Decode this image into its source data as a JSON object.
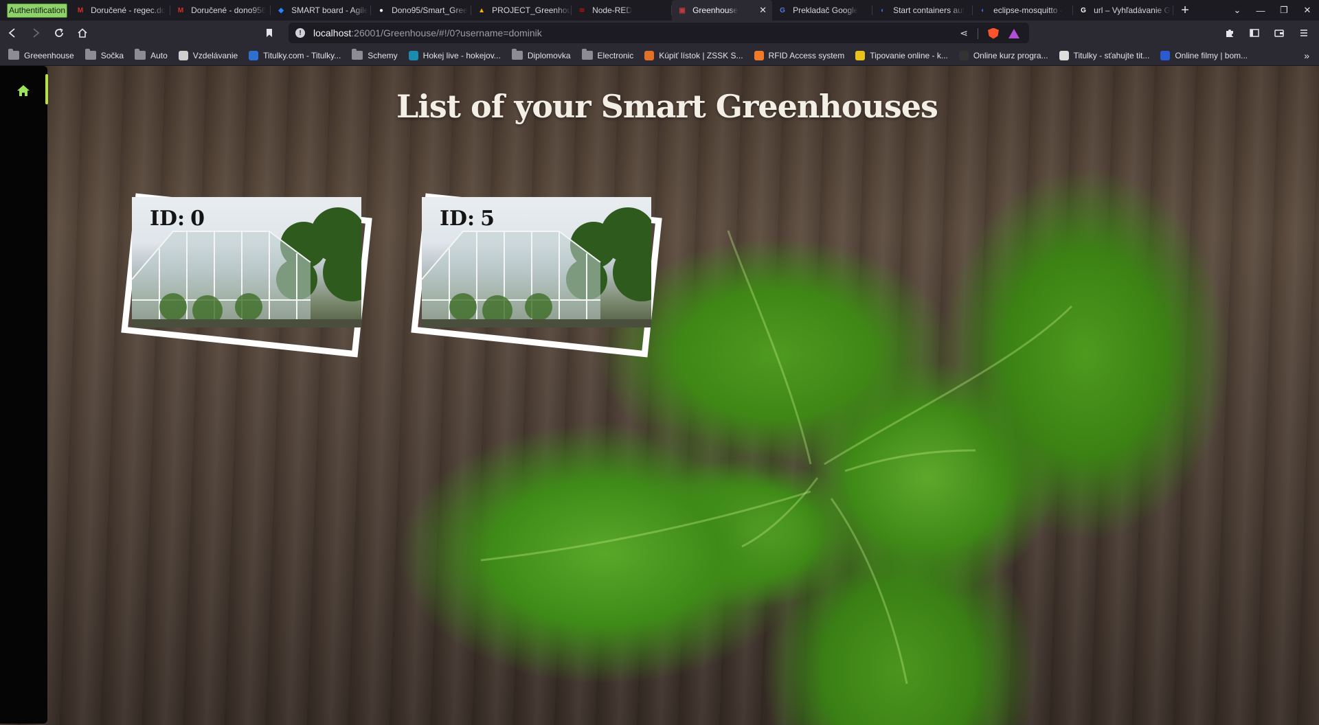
{
  "browser": {
    "auth_pill": "Authentification",
    "tabs": [
      {
        "label": "Doručené - regec.do",
        "icon": "gmail-icon",
        "color": "#d93025",
        "glyph": "M"
      },
      {
        "label": "Doručené - dono956",
        "icon": "gmail-icon",
        "color": "#d93025",
        "glyph": "M"
      },
      {
        "label": "SMART board - Agile",
        "icon": "jira-icon",
        "color": "#2684ff",
        "glyph": "◆"
      },
      {
        "label": "Dono95/Smart_Gree",
        "icon": "github-icon",
        "color": "#f0f0f0",
        "glyph": "●"
      },
      {
        "label": "PROJECT_Greenhous",
        "icon": "drive-icon",
        "color": "#f4b400",
        "glyph": "▲"
      },
      {
        "label": "Node-RED",
        "icon": "nodered-icon",
        "color": "#aa1111",
        "glyph": "≋"
      },
      {
        "label": "Greenhouse",
        "icon": "greenhouse-icon",
        "color": "#c23b3b",
        "glyph": "▣",
        "active": true
      },
      {
        "label": "Prekladač Google",
        "icon": "translate-icon",
        "color": "#4a7de8",
        "glyph": "G"
      },
      {
        "label": "Start containers aut",
        "icon": "docker-icon",
        "color": "#2d6bd9",
        "glyph": "◐"
      },
      {
        "label": "eclipse-mosquitto - ",
        "icon": "docker-icon",
        "color": "#2d6bd9",
        "glyph": "◐"
      },
      {
        "label": "url – Vyhľadávanie G",
        "icon": "google-icon",
        "color": "#ffffff",
        "glyph": "G"
      }
    ],
    "url_host": "localhost",
    "url_path": ":26001/Greenhouse/#!/0?username=dominik",
    "bookmarks": [
      {
        "label": "Greeenhouse",
        "type": "folder"
      },
      {
        "label": "Sočka",
        "type": "folder"
      },
      {
        "label": "Auto",
        "type": "folder"
      },
      {
        "label": "Vzdelávanie",
        "type": "site",
        "color": "#cfcfcf"
      },
      {
        "label": "Titulky.com - Titulky...",
        "type": "site",
        "color": "#2f6fd0"
      },
      {
        "label": "Schemy",
        "type": "folder"
      },
      {
        "label": "Hokej live - hokejov...",
        "type": "site",
        "color": "#1c8bb0"
      },
      {
        "label": "Diplomovka",
        "type": "folder"
      },
      {
        "label": "Electronic",
        "type": "folder"
      },
      {
        "label": "Kúpiť lístok | ZSSK S...",
        "type": "site",
        "color": "#e0702a"
      },
      {
        "label": "RFID Access system",
        "type": "site",
        "color": "#f07a2a"
      },
      {
        "label": "Tipovanie online - k...",
        "type": "site",
        "color": "#e8c31c"
      },
      {
        "label": "Online kurz progra...",
        "type": "site",
        "color": "#333333"
      },
      {
        "label": "Titulky - sťahujte tit...",
        "type": "site",
        "color": "#dddddd"
      },
      {
        "label": "Online filmy | bom...",
        "type": "site",
        "color": "#2a5bd0"
      }
    ]
  },
  "page": {
    "title": "List of your Smart Greenhouses",
    "greenhouses": [
      {
        "id_prefix": "ID:",
        "id": "0"
      },
      {
        "id_prefix": "ID:",
        "id": "5"
      }
    ]
  },
  "colors": {
    "accent": "#9be35a",
    "sidebar": "#050505"
  }
}
